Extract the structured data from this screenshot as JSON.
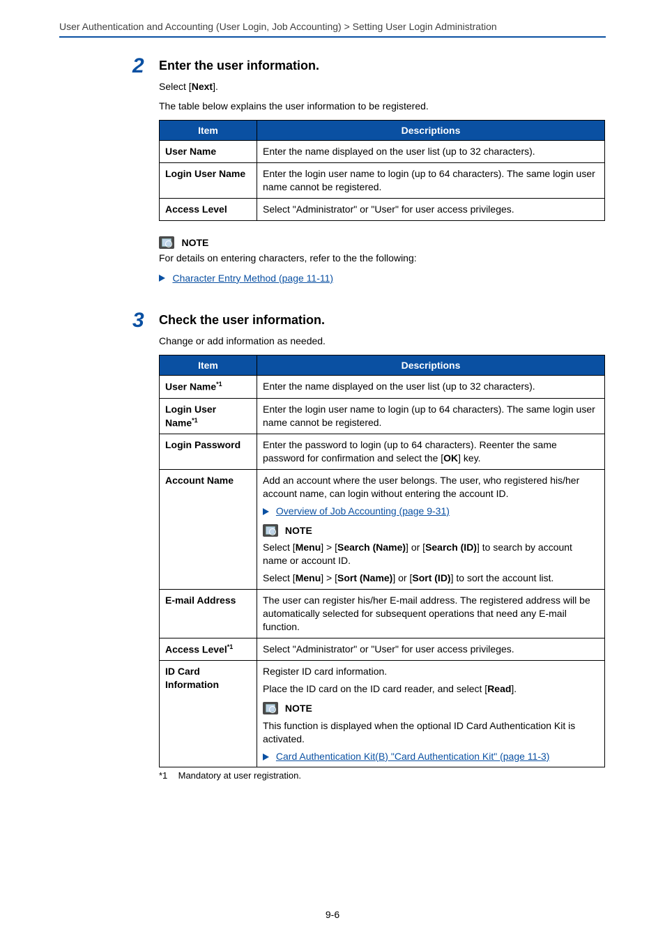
{
  "breadcrumb": "User Authentication and Accounting (User Login, Job Accounting) > Setting User Login Administration",
  "page_number": "9-6",
  "step2": {
    "number": "2",
    "title": "Enter the user information.",
    "select_prefix": "Select [",
    "select_bold": "Next",
    "select_suffix": "].",
    "intro": "The table below explains the user information to be registered.",
    "th_item": "Item",
    "th_desc": "Descriptions",
    "rows": [
      {
        "item": "User Name",
        "desc": "Enter the name displayed on the user list (up to 32 characters)."
      },
      {
        "item": "Login User Name",
        "desc": "Enter the login user name to login (up to 64 characters). The same login user name cannot be registered."
      },
      {
        "item": "Access Level",
        "desc": "Select \"Administrator\" or \"User\" for user access privileges."
      }
    ],
    "note_label": "NOTE",
    "note_text": "For details on entering characters, refer to the the following:",
    "note_link": "Character Entry Method (page 11-11)"
  },
  "step3": {
    "number": "3",
    "title": "Check the user information.",
    "intro": "Change or add information as needed.",
    "th_item": "Item",
    "th_desc": "Descriptions",
    "note_label": "NOTE",
    "rows": {
      "user_name": {
        "item": "User Name",
        "sup": "*1",
        "desc": "Enter the name displayed on the user list (up to 32 characters)."
      },
      "login_user_name": {
        "item_line1": "Login User",
        "item_line2": "Name",
        "sup": "*1",
        "desc": "Enter the login user name to login (up to 64 characters). The same login user name cannot be registered."
      },
      "login_password": {
        "item": "Login Password",
        "desc_prefix": "Enter the password to login (up to 64 characters). Reenter the same password for confirmation and select the [",
        "desc_bold": "OK",
        "desc_suffix": "] key."
      },
      "account_name": {
        "item": "Account Name",
        "desc1": "Add an account where the user belongs. The user, who registered his/her account name, can login without entering the account ID.",
        "link": "Overview of Job Accounting (page 9-31)",
        "note_select_a": "Select [",
        "note_menu": "Menu",
        "note_gt": "] > [",
        "note_search_name": "Search (Name)",
        "note_or": "] or [",
        "note_search_id": "Search (ID)",
        "note_select_a_suffix": "] to search by account name or account ID.",
        "note_sort_prefix": "Select  [",
        "note_sort_name": "Sort (Name)",
        "note_sort_id": "Sort (ID)",
        "note_sort_suffix": "] to sort the account list."
      },
      "email": {
        "item": "E-mail Address",
        "desc": "The user can register his/her E-mail address. The registered address will be automatically selected for subsequent operations that need any E-mail function."
      },
      "access_level": {
        "item": "Access Level",
        "sup": "*1",
        "desc": "Select \"Administrator\" or \"User\" for user access privileges."
      },
      "id_card": {
        "item_line1": "ID Card",
        "item_line2": "Information",
        "desc1": "Register ID card information.",
        "desc2_prefix": "Place the ID card on the ID card reader, and select [",
        "desc2_bold": "Read",
        "desc2_suffix": "].",
        "note_text": "This function is displayed when the optional ID Card Authentication Kit is activated.",
        "link": "Card Authentication Kit(B) \"Card Authentication Kit\" (page 11-3)"
      }
    }
  },
  "footnote": {
    "mark": "*1",
    "text": "Mandatory at user registration."
  }
}
